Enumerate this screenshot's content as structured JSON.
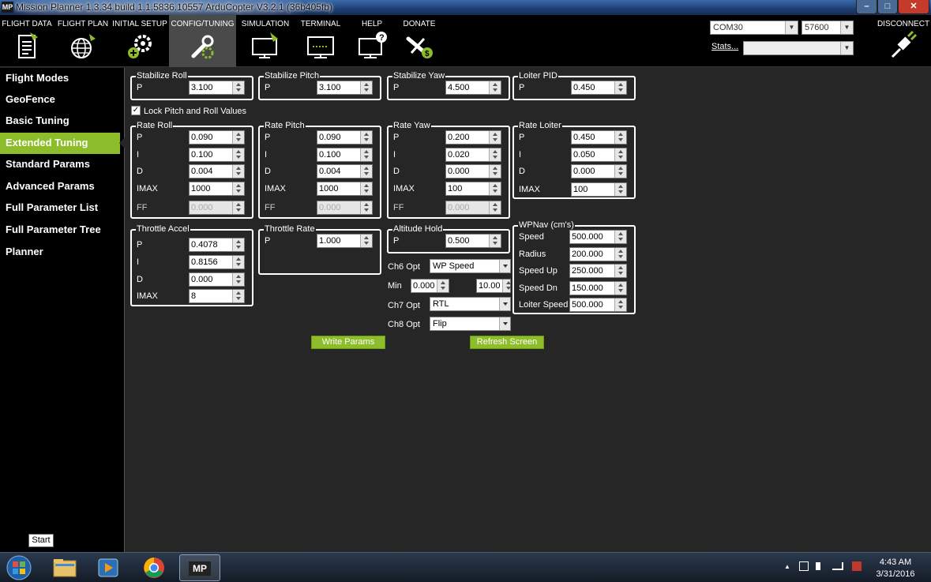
{
  "window": {
    "title": "Mission Planner 1.3.34 build 1.1.5836.10557 ArduCopter V3.2.1 (36b405fb)",
    "app_icon": "MP",
    "minimize_label": "–",
    "maximize_label": "□",
    "close_label": "✕"
  },
  "menu": {
    "items": [
      {
        "label": "FLIGHT DATA",
        "icon": "clipboard-icon"
      },
      {
        "label": "FLIGHT PLAN",
        "icon": "globe-icon"
      },
      {
        "label": "INITIAL SETUP",
        "icon": "gears-icon"
      },
      {
        "label": "CONFIG/TUNING",
        "icon": "wrench-gear-icon"
      },
      {
        "label": "SIMULATION",
        "icon": "monitor-plane-icon"
      },
      {
        "label": "TERMINAL",
        "icon": "terminal-icon"
      },
      {
        "label": "HELP",
        "icon": "help-monitor-icon"
      },
      {
        "label": "DONATE",
        "icon": "donate-plane-icon"
      }
    ],
    "port": "COM30",
    "baud": "57600",
    "stats_label": "Stats...",
    "disconnect_label": "DISCONNECT"
  },
  "sidebar": {
    "items": [
      {
        "label": "Flight Modes"
      },
      {
        "label": "GeoFence"
      },
      {
        "label": "Basic Tuning"
      },
      {
        "label": "Extended Tuning",
        "active": true
      },
      {
        "label": "Standard Params"
      },
      {
        "label": "Advanced Params"
      },
      {
        "label": "Full Parameter List"
      },
      {
        "label": "Full Parameter Tree"
      },
      {
        "label": "Planner"
      }
    ],
    "start_tooltip": "Start"
  },
  "tuning": {
    "stabilize_roll": {
      "title": "Stabilize Roll",
      "p_label": "P",
      "p": "3.100"
    },
    "stabilize_pitch": {
      "title": "Stabilize Pitch",
      "p_label": "P",
      "p": "3.100"
    },
    "stabilize_yaw": {
      "title": "Stabilize Yaw",
      "p_label": "P",
      "p": "4.500"
    },
    "loiter_pid": {
      "title": "Loiter PID",
      "p_label": "P",
      "p": "0.450"
    },
    "lock_label": "Lock Pitch and Roll Values",
    "lock_checked": "✓",
    "rate_roll": {
      "title": "Rate Roll",
      "labels": [
        "P",
        "I",
        "D",
        "IMAX",
        "FF"
      ],
      "values": [
        "0.090",
        "0.100",
        "0.004",
        "1000",
        "0.000"
      ]
    },
    "rate_pitch": {
      "title": "Rate Pitch",
      "labels": [
        "P",
        "I",
        "D",
        "IMAX",
        "FF"
      ],
      "values": [
        "0.090",
        "0.100",
        "0.004",
        "1000",
        "0.000"
      ]
    },
    "rate_yaw": {
      "title": "Rate Yaw",
      "labels": [
        "P",
        "I",
        "D",
        "IMAX",
        "FF"
      ],
      "values": [
        "0.200",
        "0.020",
        "0.000",
        "100",
        "0.000"
      ]
    },
    "rate_loiter": {
      "title": "Rate Loiter",
      "labels": [
        "P",
        "I",
        "D",
        "IMAX"
      ],
      "values": [
        "0.450",
        "0.050",
        "0.000",
        "100"
      ]
    },
    "throttle_accel": {
      "title": "Throttle Accel",
      "labels": [
        "P",
        "I",
        "D",
        "IMAX"
      ],
      "values": [
        "0.4078",
        "0.8156",
        "0.000",
        "8"
      ]
    },
    "throttle_rate": {
      "title": "Throttle Rate",
      "p_label": "P",
      "p": "1.000"
    },
    "altitude_hold": {
      "title": "Altitude Hold",
      "p_label": "P",
      "p": "0.500"
    },
    "wpnav": {
      "title": "WPNav (cm's)",
      "labels": [
        "Speed",
        "Radius",
        "Speed Up",
        "Speed Dn",
        "Loiter Speed"
      ],
      "values": [
        "500.000",
        "200.000",
        "250.000",
        "150.000",
        "500.000"
      ]
    },
    "ch6_label": "Ch6 Opt",
    "ch6_value": "WP Speed",
    "min_label": "Min",
    "min_value": "0.000",
    "max_value": "10.00",
    "ch7_label": "Ch7 Opt",
    "ch7_value": "RTL",
    "ch8_label": "Ch8 Opt",
    "ch8_value": "Flip",
    "write_label": "Write Params",
    "refresh_label": "Refresh Screen"
  },
  "taskbar": {
    "apps": [
      "windows-start-icon",
      "explorer-icon",
      "media-player-icon",
      "chrome-icon",
      "mission-planner-icon"
    ],
    "mp_label": "MP",
    "time": "4:43 AM",
    "date": "3/31/2016",
    "tray_arrow": "▲"
  }
}
